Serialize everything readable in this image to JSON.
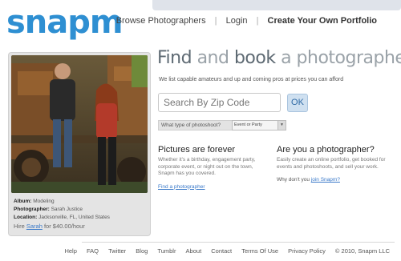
{
  "brand": {
    "logo": "snapm"
  },
  "nav": {
    "browse": "Browse Photographers",
    "login": "Login",
    "create": "Create Your Own Portfolio",
    "separator": "|"
  },
  "featured": {
    "album_label": "Album:",
    "album": "Modeling",
    "photographer_label": "Photographer:",
    "photographer": "Sarah Justice",
    "location_label": "Location:",
    "location": "Jacksonville, FL, United States",
    "hire_prefix": "Hire",
    "hire_name": "Sarah",
    "hire_suffix": "for $40.00/hour"
  },
  "hero": {
    "headline_part1": "Find",
    "headline_part2": " and ",
    "headline_part3": "book",
    "headline_part4": " a photographer.",
    "subtext": "We list capable amateurs and up and coming pros at prices you can afford"
  },
  "search": {
    "placeholder": "Search By Zip Code",
    "ok_label": "OK",
    "type_label": "What type of photoshoot?",
    "type_value": "Event or Party"
  },
  "pictures": {
    "title": "Pictures are forever",
    "body": "Whether it's a birthday, engagement party, corporate event, or night out on the town, Snapm has you covered.",
    "link": "Find a photographer"
  },
  "photographer_cta": {
    "title": "Are you a photographer?",
    "body": "Easily create an online portfolio, get booked for events and photoshoots, and sell your work.",
    "prompt": "Why don't you",
    "link": "join Snapm?"
  },
  "footer": {
    "items": [
      "Help",
      "FAQ",
      "Twitter",
      "Blog",
      "Tumblr",
      "About",
      "Contact",
      "Terms Of Use",
      "Privacy Policy"
    ],
    "copyright": "© 2010, Snapm LLC"
  },
  "colors": {
    "brand": "#2e8fd2",
    "link": "#3a79c9",
    "ok_bg": "#cfe0f0"
  }
}
